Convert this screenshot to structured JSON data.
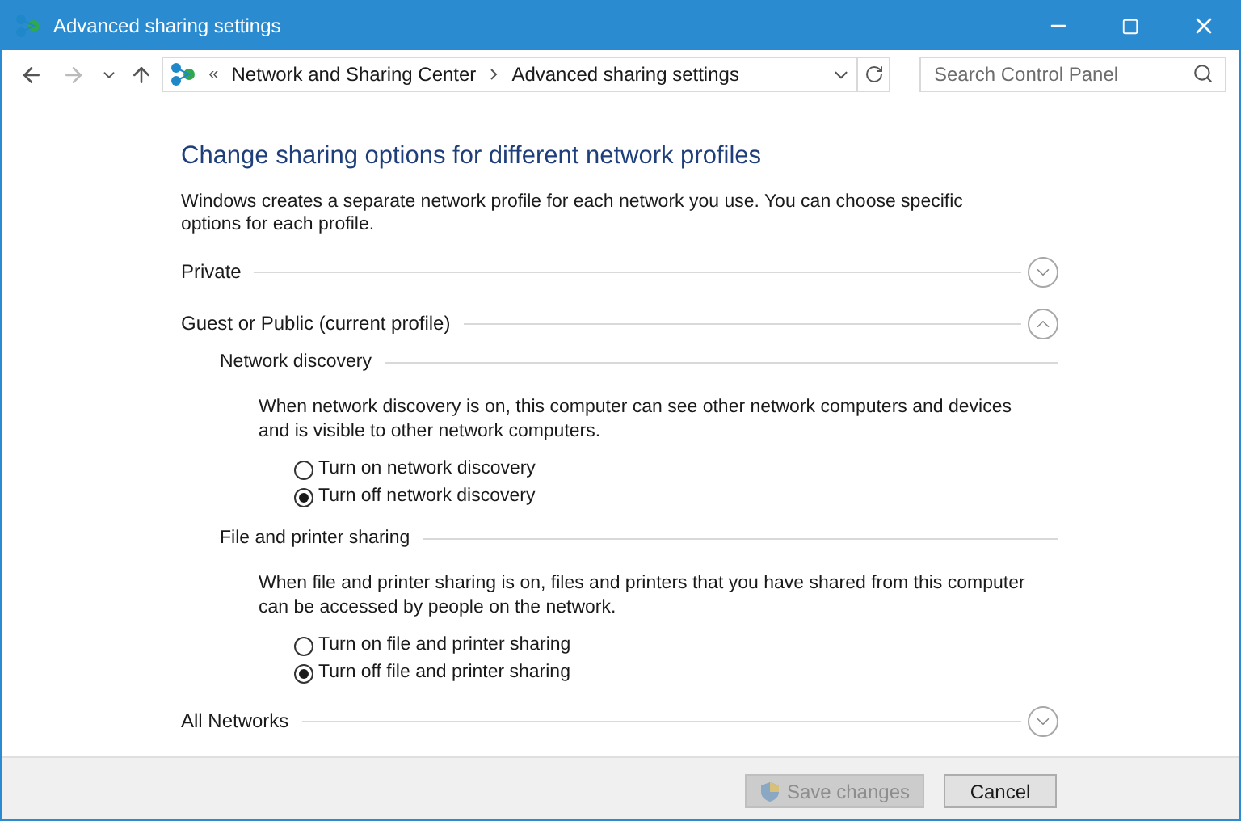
{
  "window": {
    "title": "Advanced sharing settings"
  },
  "address_bar": {
    "overflow": "«",
    "breadcrumbs": [
      "Network and Sharing Center",
      "Advanced sharing settings"
    ]
  },
  "search": {
    "placeholder": "Search Control Panel"
  },
  "heading": "Change sharing options for different network profiles",
  "intro": "Windows creates a separate network profile for each network you use. You can choose specific options for each profile.",
  "profiles": [
    {
      "title": "Private",
      "expanded": false
    },
    {
      "title": "Guest or Public (current profile)",
      "expanded": true,
      "sections": [
        {
          "title": "Network discovery",
          "description": "When network discovery is on, this computer can see other network computers and devices and is visible to other network computers.",
          "options": [
            {
              "label": "Turn on network discovery",
              "selected": false
            },
            {
              "label": "Turn off network discovery",
              "selected": true
            }
          ]
        },
        {
          "title": "File and printer sharing",
          "description": "When file and printer sharing is on, files and printers that you have shared from this computer can be accessed by people on the network.",
          "options": [
            {
              "label": "Turn on file and printer sharing",
              "selected": false
            },
            {
              "label": "Turn off file and printer sharing",
              "selected": true
            }
          ]
        }
      ]
    },
    {
      "title": "All Networks",
      "expanded": false
    }
  ],
  "buttons": [
    {
      "label": "Save changes",
      "disabled": true,
      "shield": true
    },
    {
      "label": "Cancel",
      "disabled": false,
      "shield": false
    }
  ]
}
